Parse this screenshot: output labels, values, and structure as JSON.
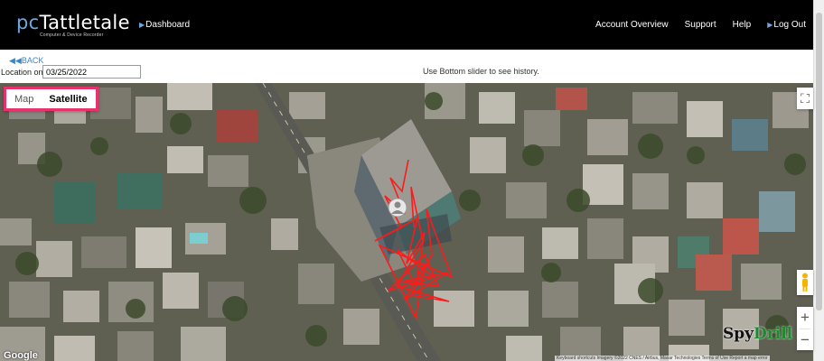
{
  "app": {
    "logo": "pcTattletale",
    "logo_prefix": "pc",
    "logo_name": "Tattletale",
    "tagline": "Computer & Device Recorder"
  },
  "nav": {
    "dashboard": "Dashboard",
    "account_overview": "Account Overview",
    "support": "Support",
    "help": "Help",
    "logout": "Log Out"
  },
  "controls": {
    "back": "BACK",
    "location_label": "Location on:",
    "location_date": "03/25/2022",
    "hint": "Use Bottom slider to see history."
  },
  "map": {
    "type_map": "Map",
    "type_satellite": "Satellite",
    "selected_type": "Satellite",
    "zoom_in": "+",
    "zoom_out": "−",
    "fullscreen_icon": "fullscreen-icon",
    "pegman_icon": "pegman-icon",
    "marker_icon": "person-marker-icon",
    "google_logo": "Google",
    "attribution": "Keyboard shortcuts   Imagery ©2022 CNES / Airbus, Maxar Technologies   Terms of Use   Report a map error",
    "track_color": "#ff1a1a",
    "highlight_color": "#e7336b"
  },
  "watermark": {
    "part1": "Spy",
    "part2": "Drill"
  },
  "colors": {
    "topbar": "#000000",
    "accent": "#6fa8dc",
    "link": "#3d85c6"
  }
}
